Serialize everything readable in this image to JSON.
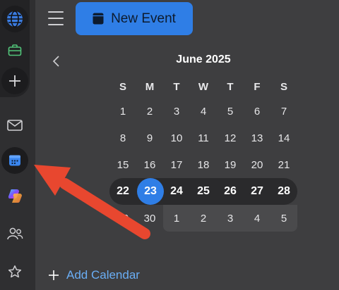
{
  "header": {
    "new_event_label": "New Event"
  },
  "calendar": {
    "month_title": "June 2025",
    "weekdays": [
      "S",
      "M",
      "T",
      "W",
      "T",
      "F",
      "S"
    ],
    "weeks": [
      [
        "1",
        "2",
        "3",
        "4",
        "5",
        "6",
        "7"
      ],
      [
        "8",
        "9",
        "10",
        "11",
        "12",
        "13",
        "14"
      ],
      [
        "15",
        "16",
        "17",
        "18",
        "19",
        "20",
        "21"
      ],
      [
        "22",
        "23",
        "24",
        "25",
        "26",
        "27",
        "28"
      ],
      [
        "29",
        "30",
        "1",
        "2",
        "3",
        "4",
        "5"
      ]
    ],
    "today": "23"
  },
  "footer": {
    "add_calendar_label": "Add Calendar"
  },
  "colors": {
    "accent": "#2f7ee6",
    "link": "#6aaef5",
    "annotation_arrow": "#e8472f"
  },
  "rail_icons": [
    "globe-icon",
    "briefcase-icon",
    "plus-icon",
    "mail-icon",
    "calendar-icon",
    "copilot-icon",
    "people-icon",
    "star-icon"
  ]
}
